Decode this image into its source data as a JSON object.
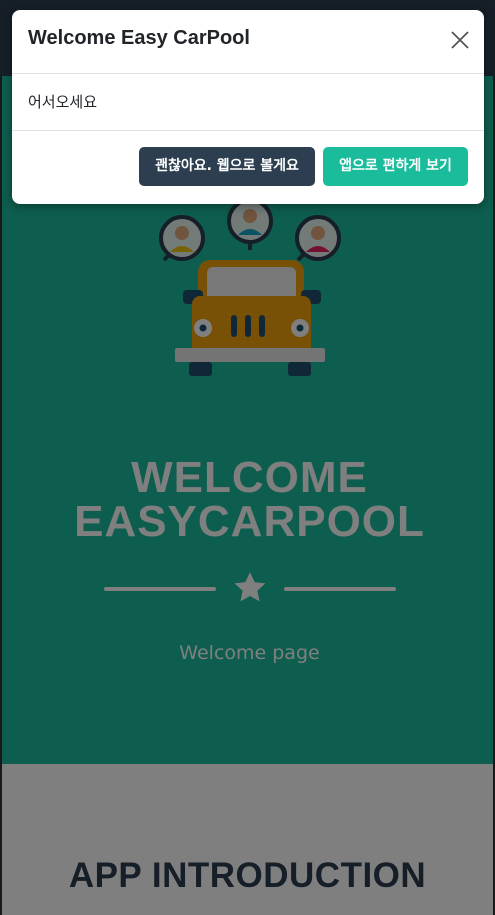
{
  "masthead": {
    "title_line1": "WELCOME",
    "title_line2": "EASYCARPOOL",
    "subtitle": "Welcome page",
    "icons": [
      "bus-icon",
      "passenger-icon",
      "star-icon"
    ]
  },
  "intro": {
    "title": "APP INTRODUCTION"
  },
  "modal": {
    "title": "Welcome Easy CarPool",
    "body": "어서오세요",
    "web_button": "괜찮아요. 웹으로 볼게요",
    "app_button": "앱으로 편하게 보기",
    "close_icon": "close-icon"
  },
  "colors": {
    "primary": "#2c3e50",
    "accent": "#1abc9c"
  }
}
